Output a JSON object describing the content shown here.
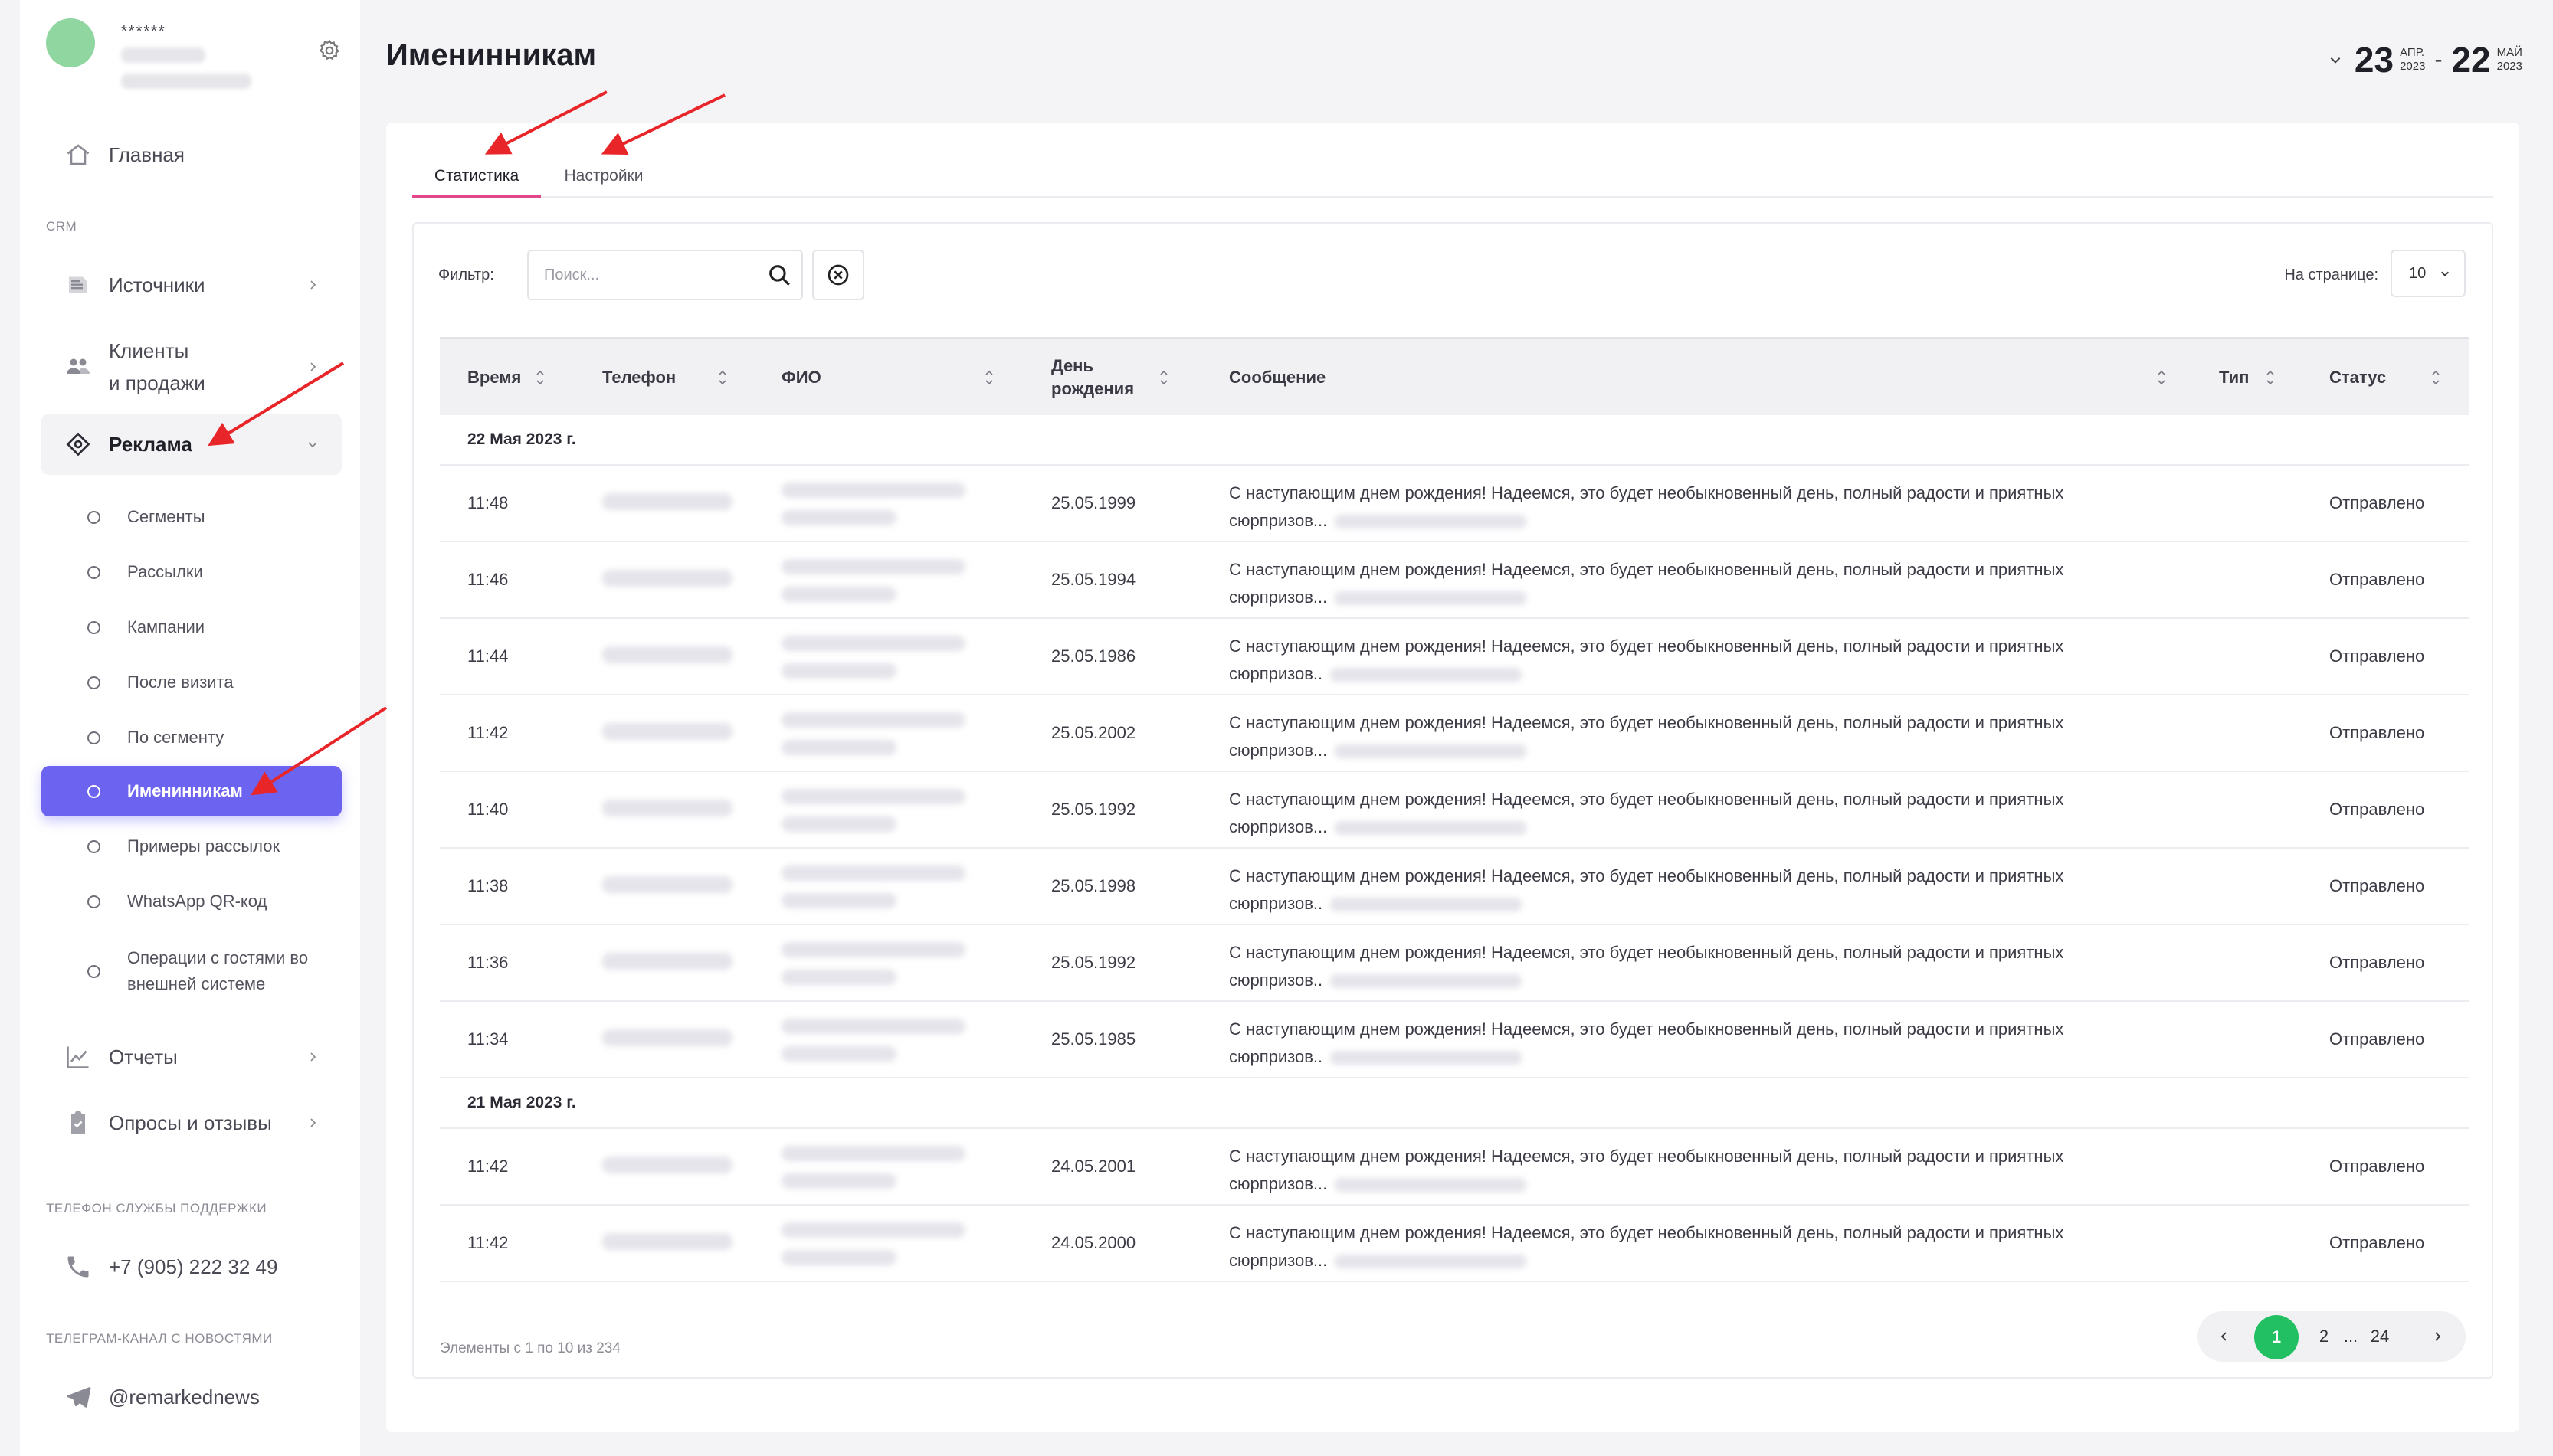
{
  "profile": {
    "name": "******"
  },
  "sidebar": {
    "home": "Главная",
    "crm_label": "CRM",
    "items": [
      {
        "label": "Источники"
      },
      {
        "label": "Клиенты\nи продажи"
      },
      {
        "label": "Реклама"
      }
    ],
    "sub_items": [
      {
        "label": "Сегменты"
      },
      {
        "label": "Рассылки"
      },
      {
        "label": "Кампании"
      },
      {
        "label": "После визита"
      },
      {
        "label": "По сегменту"
      },
      {
        "label": "Именинникам"
      },
      {
        "label": "Примеры рассылок"
      },
      {
        "label": "WhatsApp QR-код"
      },
      {
        "label": "Операции с гостями во внешней системе"
      }
    ],
    "reports": "Отчеты",
    "surveys": "Опросы и отзывы",
    "support_label": "ТЕЛЕФОН СЛУЖБЫ ПОДДЕРЖКИ",
    "support_phone": "+7 (905) 222 32 49",
    "telegram_label": "ТЕЛЕГРАМ-КАНАЛ С НОВОСТЯМИ",
    "telegram": "@remarkednews"
  },
  "header": {
    "title": "Именинникам",
    "date_from": {
      "day": "23",
      "month": "АПР.",
      "year": "2023"
    },
    "date_to": {
      "day": "22",
      "month": "МАЙ",
      "year": "2023"
    }
  },
  "tabs": [
    {
      "label": "Статистика"
    },
    {
      "label": "Настройки"
    }
  ],
  "filter": {
    "label": "Фильтр:",
    "placeholder": "Поиск...",
    "per_page_label": "На странице:",
    "per_page_value": "10"
  },
  "table": {
    "columns": [
      "Время",
      "Телефон",
      "ФИО",
      "День рождения",
      "Сообщение",
      "Тип",
      "Статус"
    ],
    "message_text": "С наступающим днем рождения! Надеемся, это будет необыкновенный день, полный радости и приятных",
    "groups": [
      {
        "date": "22 Мая 2023 г.",
        "rows": [
          {
            "time": "11:48",
            "birthday": "25.05.1999",
            "msg_tail": "сюрпризов...",
            "status": "Отправлено"
          },
          {
            "time": "11:46",
            "birthday": "25.05.1994",
            "msg_tail": "сюрпризов...",
            "status": "Отправлено"
          },
          {
            "time": "11:44",
            "birthday": "25.05.1986",
            "msg_tail": "сюрпризов..",
            "status": "Отправлено"
          },
          {
            "time": "11:42",
            "birthday": "25.05.2002",
            "msg_tail": "сюрпризов...",
            "status": "Отправлено"
          },
          {
            "time": "11:40",
            "birthday": "25.05.1992",
            "msg_tail": "сюрпризов...",
            "status": "Отправлено"
          },
          {
            "time": "11:38",
            "birthday": "25.05.1998",
            "msg_tail": "сюрпризов..",
            "status": "Отправлено"
          },
          {
            "time": "11:36",
            "birthday": "25.05.1992",
            "msg_tail": "сюрпризов..",
            "status": "Отправлено"
          },
          {
            "time": "11:34",
            "birthday": "25.05.1985",
            "msg_tail": "сюрпризов..",
            "status": "Отправлено"
          }
        ]
      },
      {
        "date": "21 Мая 2023 г.",
        "rows": [
          {
            "time": "11:42",
            "birthday": "24.05.2001",
            "msg_tail": "сюрпризов...",
            "status": "Отправлено"
          },
          {
            "time": "11:42",
            "birthday": "24.05.2000",
            "msg_tail": "сюрпризов...",
            "status": "Отправлено"
          }
        ]
      }
    ]
  },
  "footer": {
    "info": "Элементы с 1 по 10 из 234",
    "pages": [
      "1",
      "2",
      "...",
      "24"
    ]
  },
  "colors": {
    "accent": "#6c63f0",
    "tab_underline": "#e3468a",
    "page_active": "#22c063",
    "annotation_arrow": "#e8262a"
  }
}
